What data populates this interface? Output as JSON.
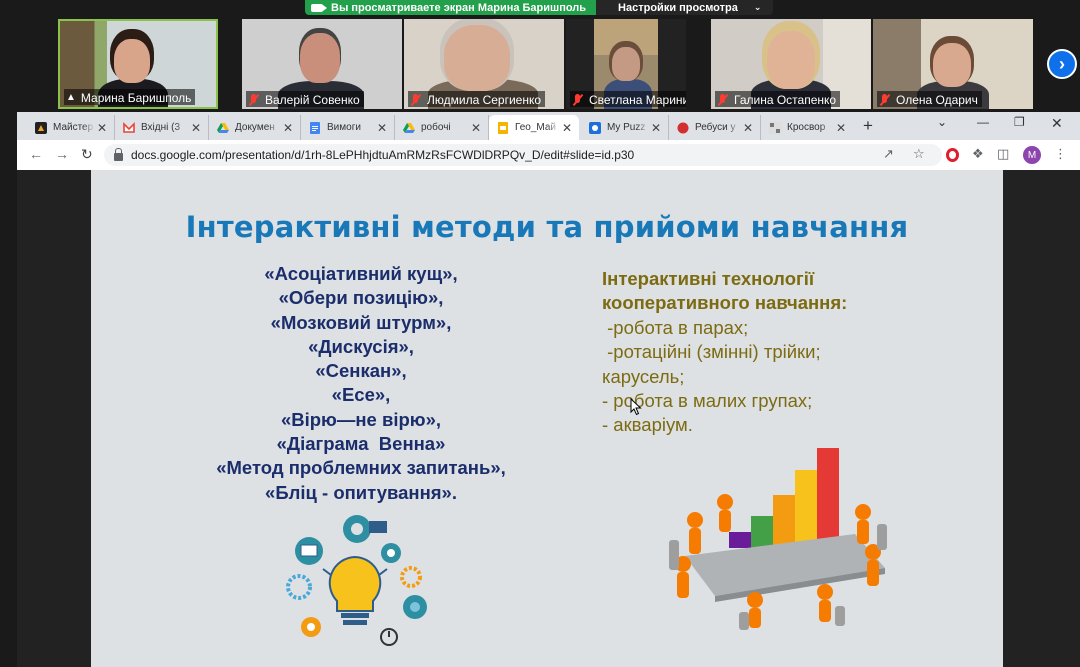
{
  "share_banner": {
    "viewing_text": "Вы просматриваете экран Марина Баришполь",
    "view_settings_label": "Настройки просмотра"
  },
  "participants": [
    {
      "name": "Марина Баришполь",
      "pinned": true,
      "muted": false
    },
    {
      "name": "Валерій Совенко",
      "pinned": false,
      "muted": true
    },
    {
      "name": "Людмила Сергиенко",
      "pinned": false,
      "muted": true
    },
    {
      "name": "Светлана Маринич",
      "pinned": false,
      "muted": true
    },
    {
      "name": "Галина Остапенко",
      "pinned": false,
      "muted": true
    },
    {
      "name": "Олена Одарич",
      "pinned": false,
      "muted": true
    }
  ],
  "browser": {
    "tabs": [
      {
        "label": "Майстер",
        "icon": "dark-square-icon"
      },
      {
        "label": "Вхідні (3",
        "icon": "gmail-icon"
      },
      {
        "label": "Докумен",
        "icon": "drive-icon"
      },
      {
        "label": "Вимоги",
        "icon": "docs-icon"
      },
      {
        "label": "робочі",
        "icon": "drive-icon"
      },
      {
        "label": "Гео_Май",
        "icon": "slides-icon",
        "active": true
      },
      {
        "label": "My Puzz",
        "icon": "puzzle-icon"
      },
      {
        "label": "Ребуси у",
        "icon": "red-circle-icon"
      },
      {
        "label": "Кросвор",
        "icon": "crossword-icon"
      }
    ],
    "url": "docs.google.com/presentation/d/1rh-8LePHhjdtuAmRMzRsFCWDlDRPQv_D/edit#slide=id.p30",
    "profile_initial": "M"
  },
  "slide": {
    "title": "Інтерактивні методи та прийоми навчання",
    "left_items": [
      "«Асоціативний кущ»,",
      "«Обери позицію»,",
      "«Мозковий штурм»,",
      "«Дискусія»,",
      "«Сенкан»,",
      "«Есе»,",
      "«Вірю—не вірю»,",
      "«Діаграма  Венна»",
      "«Метод проблемних запитань»,",
      "«Бліц - опитування»."
    ],
    "right_heading_lines": [
      "Інтерактивні технології",
      "кооперативного навчання:"
    ],
    "right_items": [
      " -робота в парах;",
      " -ротаційні (змінні) трійки;",
      "карусель;",
      "- робота в малих групах;",
      "- акваріум."
    ]
  },
  "colors": {
    "title": "#1978b8",
    "left_text": "#1b2d6b",
    "right_text": "#7d6b12",
    "zoom_green": "#23a04b",
    "zoom_blue": "#0e71eb"
  }
}
